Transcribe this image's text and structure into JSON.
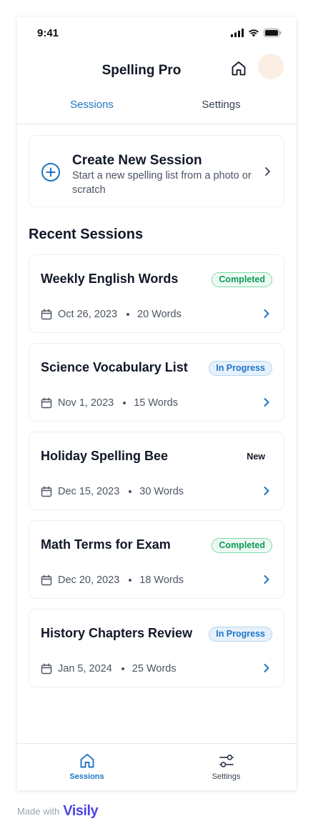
{
  "status_bar": {
    "time": "9:41",
    "icons": [
      "cellular-signal-icon",
      "wifi-icon",
      "battery-icon"
    ]
  },
  "header": {
    "title": "Spelling Pro",
    "home_icon": "home-icon",
    "avatar": "avatar"
  },
  "tabs": [
    {
      "label": "Sessions",
      "active": true
    },
    {
      "label": "Settings",
      "active": false
    }
  ],
  "create_session": {
    "icon": "plus-circle-icon",
    "title": "Create New Session",
    "subtitle": "Start a new spelling list from a photo or scratch"
  },
  "recent": {
    "title": "Recent Sessions",
    "sessions": [
      {
        "title": "Weekly English Words",
        "status": "Completed",
        "date": "Oct 26, 2023",
        "words": "20 Words"
      },
      {
        "title": "Science Vocabulary List",
        "status": "In Progress",
        "date": "Nov 1, 2023",
        "words": "15 Words"
      },
      {
        "title": "Holiday Spelling Bee",
        "status": "New",
        "date": "Dec 15, 2023",
        "words": "30 Words"
      },
      {
        "title": "Math Terms for Exam",
        "status": "Completed",
        "date": "Dec 20, 2023",
        "words": "18 Words"
      },
      {
        "title": "History Chapters Review",
        "status": "In Progress",
        "date": "Jan 5, 2024",
        "words": "25 Words"
      }
    ]
  },
  "bottom_nav": [
    {
      "label": "Sessions",
      "icon": "home-icon",
      "active": true
    },
    {
      "label": "Settings",
      "icon": "sliders-icon",
      "active": false
    }
  ],
  "footer": {
    "made_with": "Made with",
    "brand": "Visily"
  },
  "colors": {
    "accent": "#1f74c6",
    "completed": "#0f9a56",
    "in_progress": "#1f74c6",
    "brand": "#4f46e5"
  }
}
